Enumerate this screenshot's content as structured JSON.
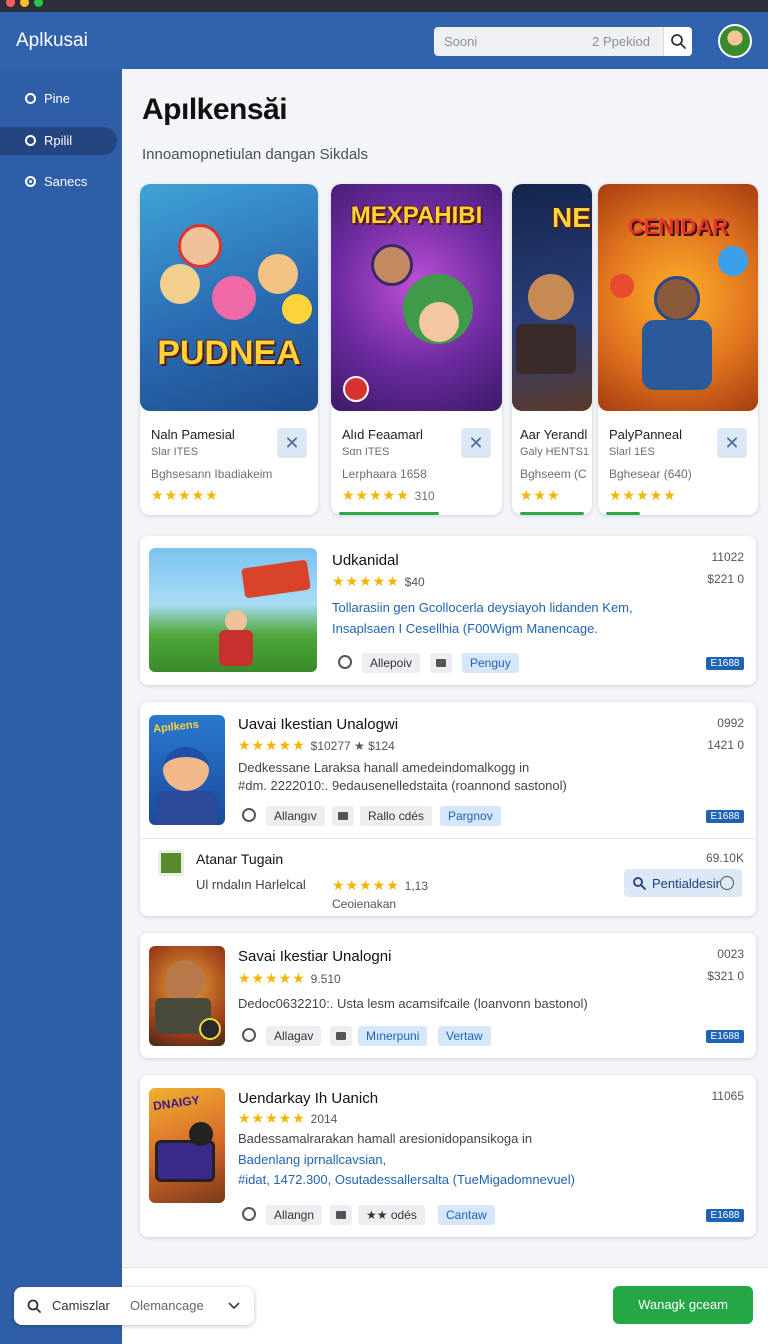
{
  "header": {
    "app_title": "Aplkusai",
    "search": {
      "placeholder": "Sooni",
      "value": "2 Ppekiod"
    }
  },
  "sidebar": {
    "items": [
      {
        "label": "Pine"
      },
      {
        "label": "Rpilil"
      },
      {
        "label": "Sanecs"
      }
    ]
  },
  "main": {
    "title": "Apılkensăi",
    "subtitle": "Innoamopnetiulan dangan Sikdals",
    "featured": [
      {
        "art_title": "PUDNEA",
        "name": "Naln Pamesial",
        "sub": "Slar ITES",
        "desc": "Bghsesann Ibadiakeim",
        "stars": "★★★★★",
        "rating": ""
      },
      {
        "art_title": "MEXPAHIBI",
        "name": "Alıd Feaamarl",
        "sub": "Sαn ITES",
        "desc": "Lerphaara 1658",
        "stars": "★★★★★",
        "rating": "310"
      },
      {
        "art_title": "NE",
        "name": "Aar Yerandl",
        "sub": "Galy HENTS1",
        "desc": "Bghseem (C",
        "stars": "★★★",
        "rating": ""
      },
      {
        "art_title": "CENIDAR",
        "name": "PalyPanneal",
        "sub": "Slarl 1ES",
        "desc": "Bghesear (640)",
        "stars": "★★★★★",
        "rating": ""
      }
    ],
    "list": [
      {
        "title": "Udkanidal",
        "stars": "★★★★★",
        "rating": "$40",
        "lines": [
          "Tollarasiin gen Gcollocerla deysiayoh lidanden Kem,",
          "Insaplsaen I Cesellhia (F00Wigm Manencage."
        ],
        "right_top": "11022",
        "right_bottom": "$221 0",
        "chips": [
          "Allepoiv",
          "Penguy"
        ],
        "badge": "E1688"
      },
      {
        "title": "Uavai Ikestian Unalogwi",
        "stars": "★★★★★",
        "rating": "$10277 ★ $124",
        "lines": [
          "Dedkessane Laraksa hanall amedeindomalkogg in",
          "#dm. 2222010:. 9edausenelledstaita (roannond sastonol)"
        ],
        "right_top": "0992",
        "right_bottom": "1421 0",
        "chips": [
          "Allangıv",
          "Rallo cdés",
          "Pargnov"
        ],
        "badge": "E1688",
        "sub_item": {
          "title": "Atanar Tugain",
          "meta": "Ul rndalın Harlelcal",
          "stars": "★★★★★",
          "rating": "1,13",
          "caption": "Ceoienakan",
          "right": "69.10K",
          "action": "Pentialdesir"
        }
      },
      {
        "title": "Savai Ikestiar Unalogni",
        "stars": "★★★★★",
        "rating": "9.510",
        "lines": [
          "Dedoc0632210:. Usta lesm acamsifcaile (loanvonn bastonol)"
        ],
        "right_top": "0023",
        "right_bottom": "$321 0",
        "chips": [
          "Allagav",
          "Mınerpuni",
          "Vertaw"
        ],
        "badge": "E1688"
      },
      {
        "title": "Uendarkay Ih Uanich",
        "stars": "★★★★★",
        "rating": "2014",
        "lines": [
          "Badessamalrarakan hamall aresionidopansikoga in"
        ],
        "links": [
          "Badenlang iprnallcavsian,",
          "#idat, 1472.300, Osutadessallersalta (TueMigadomnevuel)"
        ],
        "right_top": "11065",
        "chips": [
          "Allangn",
          "★★ odés",
          "Cantaw"
        ],
        "badge": "E1688"
      }
    ]
  },
  "footer": {
    "combo_label": "Camiszlar",
    "combo_value": "Olemancage",
    "primary_button": "Wanagk gceam"
  },
  "colors": {
    "sidebar_bg": "#2f5ea8",
    "accent_blue": "#1f63b5",
    "star": "#f5b400",
    "primary_green": "#25a745"
  },
  "icons": {
    "search": "search-icon",
    "close": "close-icon",
    "chevron": "chevron-down-icon"
  }
}
